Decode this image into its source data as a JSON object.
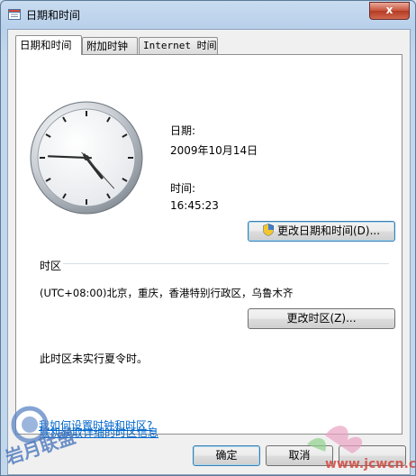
{
  "window": {
    "title": "日期和时间",
    "close_label": "x"
  },
  "tabs": [
    {
      "label": "日期和时间",
      "active": true
    },
    {
      "label": "附加时钟",
      "active": false
    },
    {
      "label": "Internet 时间",
      "active": false
    }
  ],
  "clock": {
    "hour": 16,
    "minute": 45,
    "second": 23
  },
  "date": {
    "label": "日期:",
    "value": "2009年10月14日"
  },
  "time": {
    "label": "时间:",
    "value": "16:45:23"
  },
  "buttons": {
    "change_datetime": "更改日期和时间(D)...",
    "change_timezone": "更改时区(Z)...",
    "ok": "确定",
    "cancel": "取消"
  },
  "timezone": {
    "section_label": "时区",
    "value": "(UTC+08:00)北京，重庆，香港特别行政区，乌鲁木齐",
    "dst_note": "此时区未实行夏令时。"
  },
  "links": {
    "tz_info": "联机获取详细的时区信息",
    "how_to": "我如何设置时钟和时区?"
  },
  "watermark": {
    "left_text": "岩月联盟",
    "right_text": "www.jcwcn.com"
  },
  "colors": {
    "link": "#0066cc",
    "close": "#c7523a"
  }
}
